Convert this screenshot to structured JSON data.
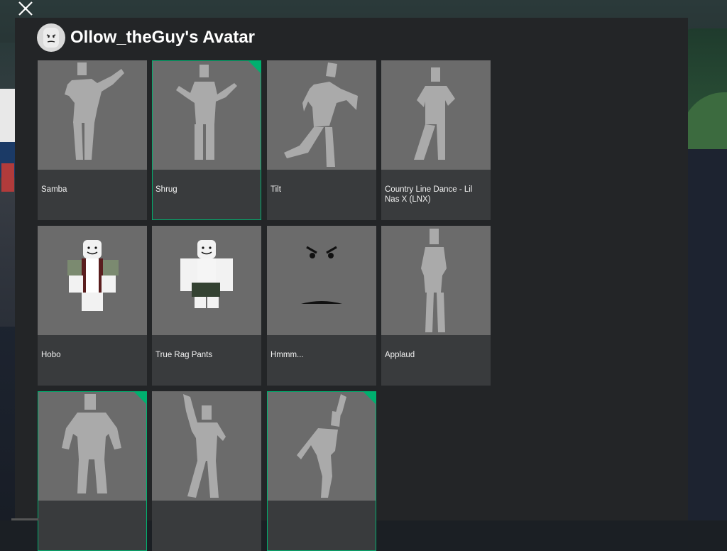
{
  "header": {
    "title": "Ollow_theGuy's Avatar"
  },
  "accent_color": "#00b06f",
  "items": [
    {
      "label": "Samba",
      "selected": false,
      "icon": "emote-samba-icon"
    },
    {
      "label": "Shrug",
      "selected": true,
      "icon": "emote-shrug-icon"
    },
    {
      "label": "Tilt",
      "selected": false,
      "icon": "emote-tilt-icon"
    },
    {
      "label": "Country Line Dance - Lil Nas X (LNX)",
      "selected": false,
      "icon": "emote-country-line-dance-icon"
    },
    {
      "label": "Hobo",
      "selected": false,
      "icon": "shirt-hobo-icon"
    },
    {
      "label": "True Rag Pants",
      "selected": false,
      "icon": "pants-true-rag-icon"
    },
    {
      "label": "Hmmm...",
      "selected": false,
      "icon": "face-hmmm-icon"
    },
    {
      "label": "Applaud",
      "selected": false,
      "icon": "emote-applaud-icon"
    },
    {
      "label": "",
      "selected": true,
      "icon": "emote-pose-icon"
    },
    {
      "label": "",
      "selected": false,
      "icon": "emote-wave-icon"
    },
    {
      "label": "",
      "selected": true,
      "icon": "emote-cheer-icon"
    }
  ]
}
